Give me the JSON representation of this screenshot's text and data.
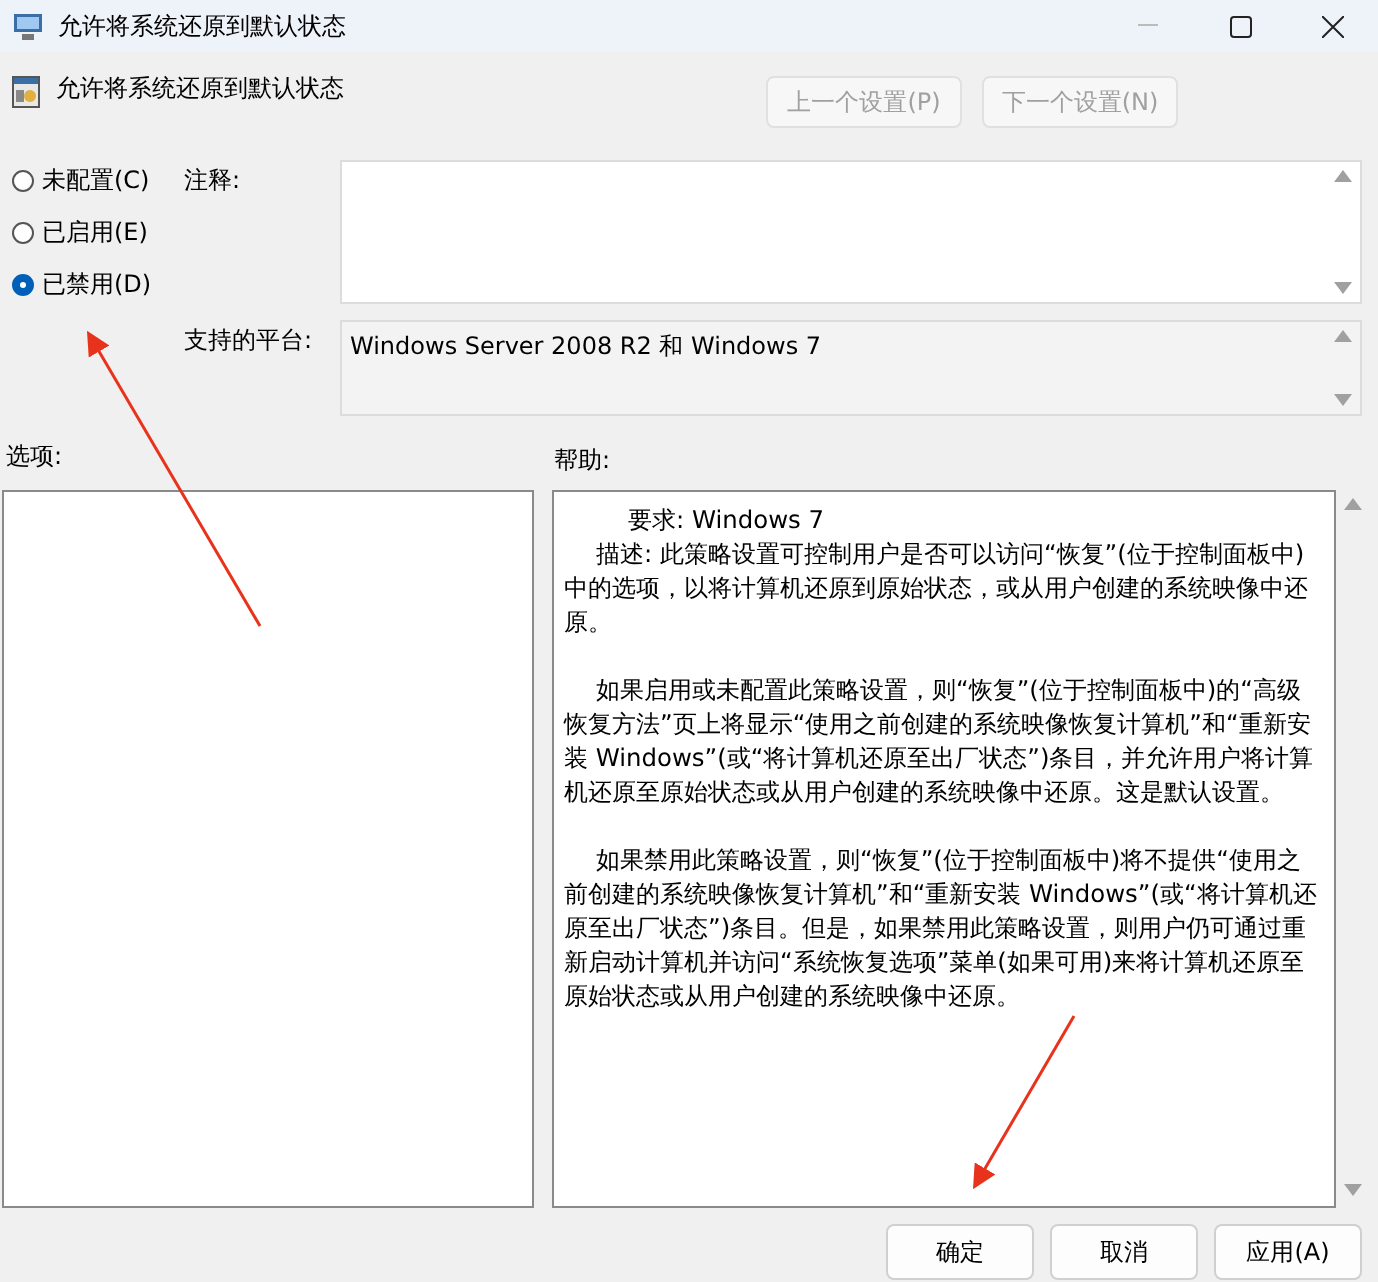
{
  "window": {
    "title": "允许将系统还原到默认状态"
  },
  "header": {
    "title": "允许将系统还原到默认状态",
    "buttons": [
      {
        "label": "上一个设置(P)",
        "disabled": true
      },
      {
        "label": "下一个设置(N)",
        "disabled": true
      }
    ]
  },
  "state_options": [
    {
      "label": "未配置(C)",
      "selected": false
    },
    {
      "label": "已启用(E)",
      "selected": false
    },
    {
      "label": "已禁用(D)",
      "selected": true
    }
  ],
  "comment": {
    "label": "注释:"
  },
  "platform": {
    "label": "支持的平台:",
    "value": "Windows Server 2008 R2 和 Windows 7"
  },
  "options": {
    "label": "选项:"
  },
  "help": {
    "label": "帮助:",
    "paragraphs": [
      {
        "kind": "requirement",
        "text": "要求: Windows 7"
      },
      {
        "kind": "text",
        "text": "描述: 此策略设置可控制用户是否可以访问“恢复”(位于控制面板中)中的选项，以将计算机还原到原始状态，或从用户创建的系统映像中还原。"
      },
      {
        "kind": "text",
        "text": "如果启用或未配置此策略设置，则“恢复”(位于控制面板中)的“高级恢复方法”页上将显示“使用之前创建的系统映像恢复计算机”和“重新安装 Windows”(或“将计算机还原至出厂状态”)条目，并允许用户将计算机还原至原始状态或从用户创建的系统映像中还原。这是默认设置。"
      },
      {
        "kind": "text",
        "text": "如果禁用此策略设置，则“恢复”(位于控制面板中)将不提供“使用之前创建的系统映像恢复计算机”和“重新安装 Windows”(或“将计算机还原至出厂状态”)条目。但是，如果禁用此策略设置，则用户仍可通过重新启动计算机并访问“系统恢复选项”菜单(如果可用)来将计算机还原至原始状态或从用户创建的系统映像中还原。"
      }
    ]
  },
  "footer": {
    "buttons": [
      "确定",
      "取消",
      "应用(A)"
    ]
  }
}
